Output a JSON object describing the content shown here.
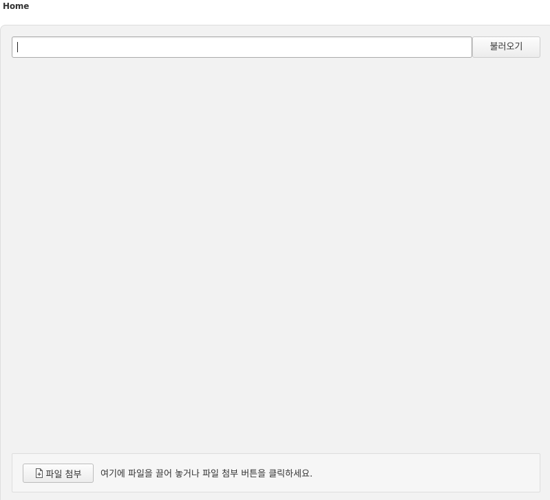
{
  "header": {
    "breadcrumb": "Home"
  },
  "url_bar": {
    "value": "",
    "load_button_label": "불러오기"
  },
  "dropzone": {
    "attach_button_label": "파일 첨부",
    "attach_icon": "file-add-icon",
    "hint": "여기에 파일을 끌어 놓거나 파일 첨부 버튼을 클릭하세요."
  },
  "colors": {
    "panel_background": "#f2f2f2",
    "page_background": "#ffffff",
    "border": "#dddddd",
    "text": "#333333"
  }
}
